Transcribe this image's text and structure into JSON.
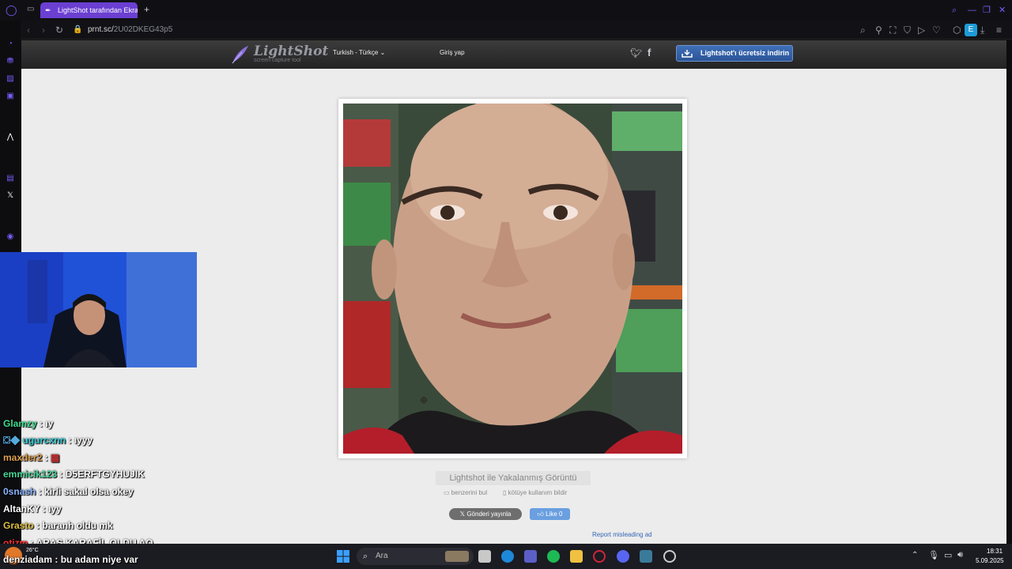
{
  "browser": {
    "tab_title": "LightShot tarafından Ekran",
    "new_tab": "+",
    "url_domain": "prnt.sc/",
    "url_path": "2U02DKEG43p5",
    "profile_letter": "E"
  },
  "lightshot": {
    "logo": "LightShot",
    "logo_sub": "screen capture tool",
    "language": "Turkish - Türkçe",
    "login": "Giriş yap",
    "download_button": "Lightshot'ı ücretsiz indirin",
    "caption": "Lightshot ile Yakalanmış Görüntü",
    "similar_link": "benzerini bul",
    "report_link": "kötüye kullanım bildir",
    "tweet_button": "Gönderi yayınla",
    "like_button": "Like 0",
    "ad_report": "Report misleading ad"
  },
  "chat": [
    {
      "user": "Glamzy",
      "message": "ıy",
      "color": "#3ce08f"
    },
    {
      "user": "ugurcxnn",
      "message": "ıyyy",
      "color": "#35c9d4"
    },
    {
      "user": "maxder2",
      "message": "",
      "color": "#e0a050"
    },
    {
      "user": "emmicik123",
      "message": "D5ERFTGYHUJIK",
      "color": "#49d69a"
    },
    {
      "user": "0snash",
      "message": "kirli sakal olsa okey",
      "color": "#8ab4ff"
    },
    {
      "user": "AltanKY",
      "message": "ıyy",
      "color": "#ffffff"
    },
    {
      "user": "Grasto",
      "message": "baranh oldu mk",
      "color": "#e0c040"
    },
    {
      "user": "otizm",
      "message": "ARAS KARAFİL OLDU AQ",
      "color": "#ff3030"
    },
    {
      "user": "denziadam",
      "message": "bu adam niye var",
      "color": "#ffffff"
    }
  ],
  "taskbar": {
    "search_placeholder": "Ara",
    "time": "18:31",
    "date": "5.09.2025",
    "temperature": "26°C"
  },
  "colors": {
    "opera_accent": "#7a5cff",
    "tab_active": "#6b3fd1",
    "download_button": "#2f5da6",
    "page_background": "#ececec"
  }
}
